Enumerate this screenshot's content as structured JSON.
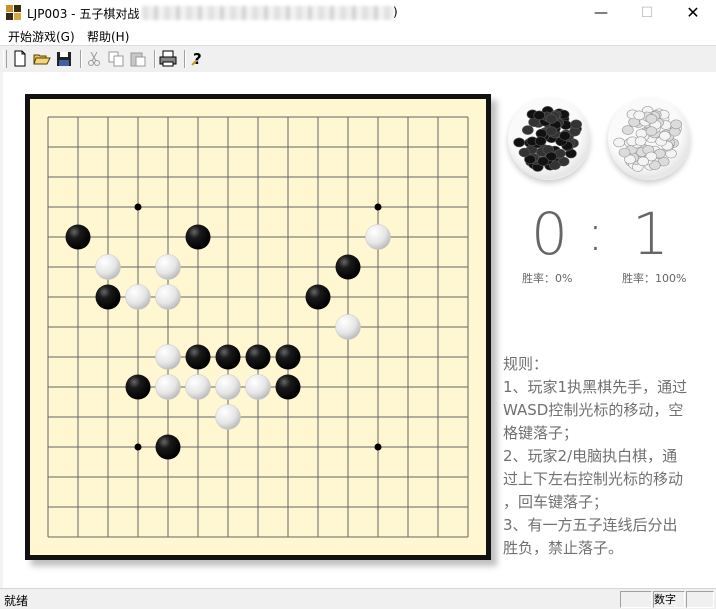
{
  "window": {
    "title": "LJP003 - 五子棋对战",
    "title_paren_close": ")",
    "min_glyph": "—",
    "max_glyph": "☐",
    "close_glyph": "✕"
  },
  "menu": {
    "items": [
      {
        "label": "开始游戏(G)"
      },
      {
        "label": "帮助(H)"
      }
    ]
  },
  "toolbar": {
    "buttons": [
      {
        "name": "new-icon"
      },
      {
        "name": "open-icon"
      },
      {
        "name": "save-icon"
      },
      {
        "name": "cut-icon"
      },
      {
        "name": "copy-icon"
      },
      {
        "name": "paste-icon"
      },
      {
        "name": "print-icon"
      },
      {
        "name": "help-icon"
      }
    ]
  },
  "board": {
    "size": 15,
    "star_points": [
      [
        3,
        3
      ],
      [
        3,
        11
      ],
      [
        11,
        3
      ],
      [
        11,
        11
      ]
    ],
    "colors": {
      "background": "#fff6d2",
      "line": "#666666",
      "frame": "#111111"
    },
    "black_stones": [
      [
        1,
        4
      ],
      [
        5,
        4
      ],
      [
        2,
        6
      ],
      [
        10,
        5
      ],
      [
        9,
        6
      ],
      [
        5,
        8
      ],
      [
        6,
        8
      ],
      [
        7,
        8
      ],
      [
        8,
        8
      ],
      [
        3,
        9
      ],
      [
        8,
        9
      ],
      [
        4,
        11
      ]
    ],
    "white_stones": [
      [
        11,
        4
      ],
      [
        2,
        5
      ],
      [
        4,
        5
      ],
      [
        3,
        6
      ],
      [
        4,
        6
      ],
      [
        10,
        7
      ],
      [
        4,
        8
      ],
      [
        4,
        9
      ],
      [
        5,
        9
      ],
      [
        6,
        9
      ],
      [
        7,
        9
      ],
      [
        6,
        10
      ]
    ]
  },
  "scoreboard": {
    "black_score": "0",
    "separator": ":",
    "white_score": "1",
    "black_rate": "胜率：0%",
    "white_rate": "胜率：100%"
  },
  "rules": {
    "heading": "规则：",
    "lines": [
      "1、玩家1执黑棋先手，通过",
      "WASD控制光标的移动，空",
      "格键落子；",
      "2、玩家2/电脑执白棋，通",
      "过上下左右控制光标的移动",
      "，回车键落子；",
      "3、有一方五子连线后分出",
      "胜负，禁止落子。"
    ]
  },
  "status": {
    "text": "就绪",
    "num_indicator": "数字"
  }
}
